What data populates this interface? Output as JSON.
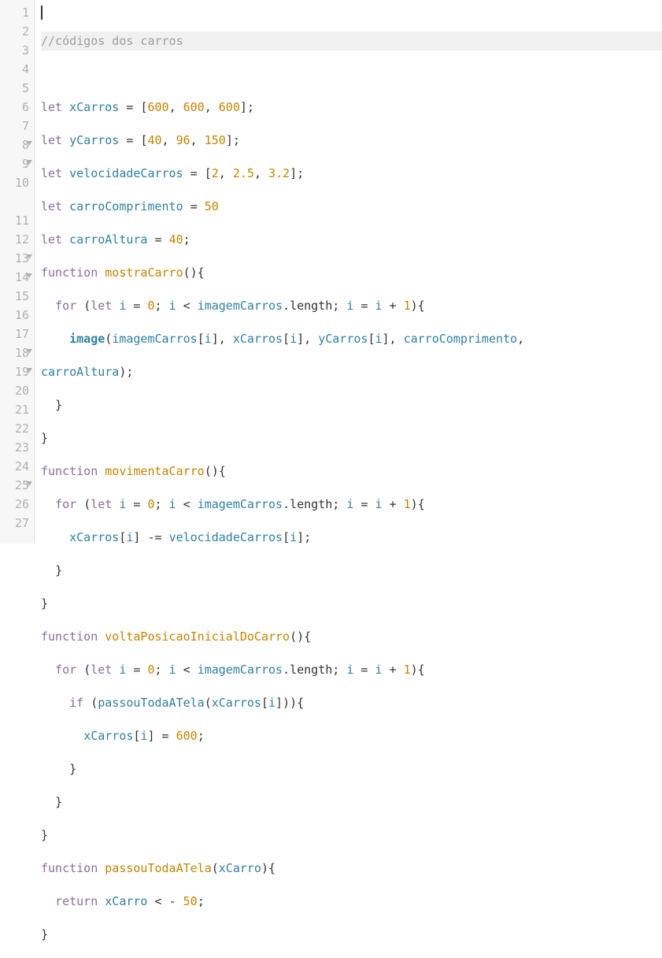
{
  "gutter": [
    {
      "n": "1",
      "fold": false
    },
    {
      "n": "2",
      "fold": false
    },
    {
      "n": "3",
      "fold": false
    },
    {
      "n": "4",
      "fold": false
    },
    {
      "n": "5",
      "fold": false
    },
    {
      "n": "6",
      "fold": false
    },
    {
      "n": "7",
      "fold": false
    },
    {
      "n": "8",
      "fold": true
    },
    {
      "n": "9",
      "fold": true
    },
    {
      "n": "10",
      "fold": false
    },
    {
      "n": "",
      "fold": false
    },
    {
      "n": "11",
      "fold": false
    },
    {
      "n": "12",
      "fold": false
    },
    {
      "n": "13",
      "fold": true
    },
    {
      "n": "14",
      "fold": true
    },
    {
      "n": "15",
      "fold": false
    },
    {
      "n": "16",
      "fold": false
    },
    {
      "n": "17",
      "fold": false
    },
    {
      "n": "18",
      "fold": true
    },
    {
      "n": "19",
      "fold": true
    },
    {
      "n": "20",
      "fold": false
    },
    {
      "n": "21",
      "fold": false
    },
    {
      "n": "22",
      "fold": false
    },
    {
      "n": "23",
      "fold": false
    },
    {
      "n": "24",
      "fold": false
    },
    {
      "n": "25",
      "fold": true
    },
    {
      "n": "26",
      "fold": false
    },
    {
      "n": "27",
      "fold": false
    }
  ],
  "tokens": {
    "comment1": "//códigos dos carros",
    "let": "let",
    "func": "function",
    "for": "for",
    "if": "if",
    "return": "return",
    "xCarros": "xCarros",
    "yCarros": "yCarros",
    "velocidadeCarros": "velocidadeCarros",
    "carroComprimento": "carroComprimento",
    "carroAltura": "carroAltura",
    "imagemCarros": "imagemCarros",
    "mostraCarro": "mostraCarro",
    "movimentaCarro": "movimentaCarro",
    "voltaPosicaoInicialDoCarro": "voltaPosicaoInicialDoCarro",
    "passouTodaATela": "passouTodaATela",
    "xCarro": "xCarro",
    "image": "image",
    "i": "i",
    "length": "length",
    "arr600": "[600, 600, 600]",
    "arrY": "[40, 96, 150]",
    "arrVel": "[2, 2.5, 3.2]",
    "n50": "50",
    "n40": "40",
    "n0": "0",
    "n1": "1",
    "n600": "600",
    "neg50": "50"
  }
}
